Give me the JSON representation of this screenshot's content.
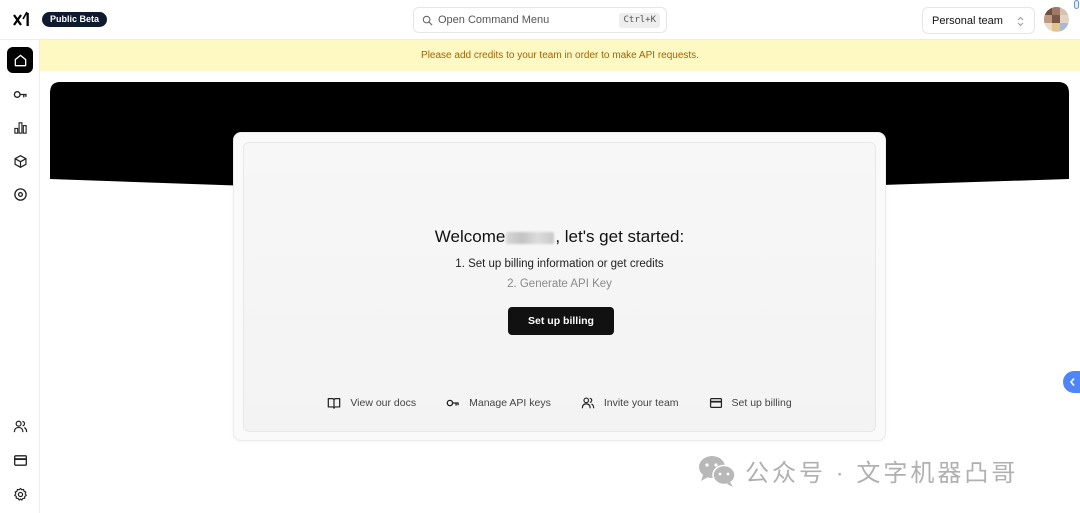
{
  "topbar": {
    "logo_name": "xAI",
    "beta_badge": "Public Beta",
    "command_menu": {
      "placeholder": "Open Command Menu",
      "shortcut": "Ctrl+K"
    },
    "team_selector": {
      "selected": "Personal team"
    }
  },
  "sidebar": {
    "top_items": [
      {
        "id": "home",
        "icon": "home-icon",
        "active": true
      },
      {
        "id": "api-keys",
        "icon": "key-icon",
        "active": false
      },
      {
        "id": "usage",
        "icon": "bar-chart-icon",
        "active": false
      },
      {
        "id": "models",
        "icon": "cube-icon",
        "active": false
      },
      {
        "id": "target",
        "icon": "target-icon",
        "active": false
      }
    ],
    "bottom_items": [
      {
        "id": "team",
        "icon": "users-icon"
      },
      {
        "id": "billing",
        "icon": "credit-card-icon"
      },
      {
        "id": "settings",
        "icon": "gear-icon"
      }
    ]
  },
  "banner": {
    "message": "Please add credits to your team in order to make API requests.",
    "bg": "#fef9c3",
    "color": "#a16207"
  },
  "welcome": {
    "prefix": "Welcome",
    "suffix": ", let's get started:",
    "steps": [
      "1. Set up billing information or get credits",
      "2. Generate API Key"
    ],
    "cta_label": "Set up billing"
  },
  "quick_links": [
    {
      "icon": "book-icon",
      "label": "View our docs"
    },
    {
      "icon": "key-icon",
      "label": "Manage API keys"
    },
    {
      "icon": "users-icon",
      "label": "Invite your team"
    },
    {
      "icon": "credit-card-icon",
      "label": "Set up billing"
    }
  ],
  "watermark": {
    "text": "公众号 · 文字机器凸哥"
  },
  "accent": "#4f86f7"
}
